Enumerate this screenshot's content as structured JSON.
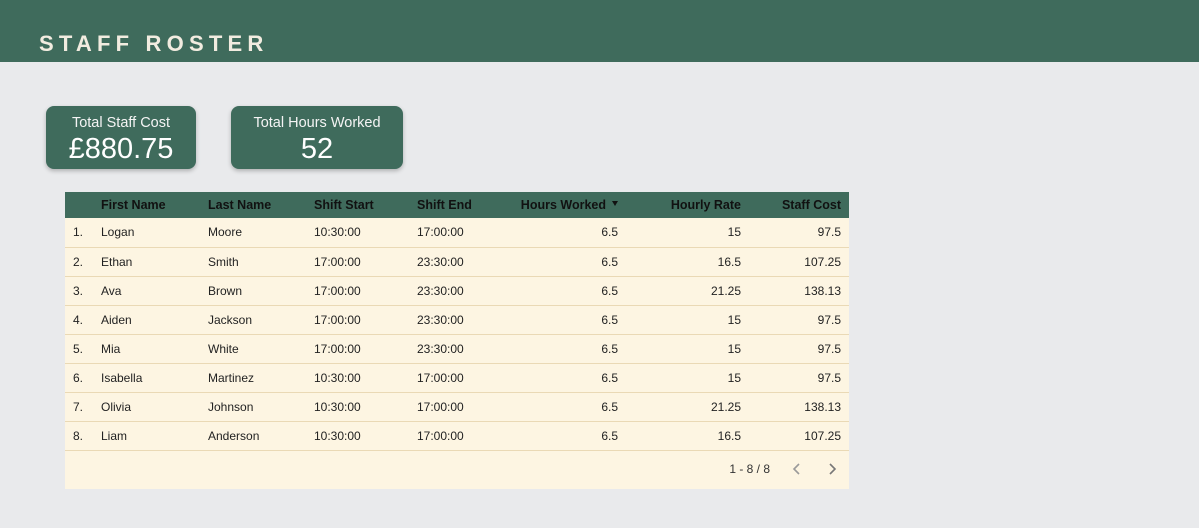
{
  "header": {
    "title": "STAFF ROSTER"
  },
  "scorecards": {
    "cost": {
      "label": "Total Staff Cost",
      "value": "£880.75"
    },
    "hours": {
      "label": "Total Hours Worked",
      "value": "52"
    }
  },
  "table": {
    "columns": [
      "First Name",
      "Last Name",
      "Shift Start",
      "Shift End",
      "Hours Worked",
      "Hourly Rate",
      "Staff Cost"
    ],
    "sort_column": "Hours Worked",
    "rows": [
      {
        "idx": "1.",
        "first": "Logan",
        "last": "Moore",
        "start": "10:30:00",
        "end": "17:00:00",
        "hours": "6.5",
        "rate": "15",
        "cost": "97.5"
      },
      {
        "idx": "2.",
        "first": "Ethan",
        "last": "Smith",
        "start": "17:00:00",
        "end": "23:30:00",
        "hours": "6.5",
        "rate": "16.5",
        "cost": "107.25"
      },
      {
        "idx": "3.",
        "first": "Ava",
        "last": "Brown",
        "start": "17:00:00",
        "end": "23:30:00",
        "hours": "6.5",
        "rate": "21.25",
        "cost": "138.13"
      },
      {
        "idx": "4.",
        "first": "Aiden",
        "last": "Jackson",
        "start": "17:00:00",
        "end": "23:30:00",
        "hours": "6.5",
        "rate": "15",
        "cost": "97.5"
      },
      {
        "idx": "5.",
        "first": "Mia",
        "last": "White",
        "start": "17:00:00",
        "end": "23:30:00",
        "hours": "6.5",
        "rate": "15",
        "cost": "97.5"
      },
      {
        "idx": "6.",
        "first": "Isabella",
        "last": "Martinez",
        "start": "10:30:00",
        "end": "17:00:00",
        "hours": "6.5",
        "rate": "15",
        "cost": "97.5"
      },
      {
        "idx": "7.",
        "first": "Olivia",
        "last": "Johnson",
        "start": "10:30:00",
        "end": "17:00:00",
        "hours": "6.5",
        "rate": "21.25",
        "cost": "138.13"
      },
      {
        "idx": "8.",
        "first": "Liam",
        "last": "Anderson",
        "start": "10:30:00",
        "end": "17:00:00",
        "hours": "6.5",
        "rate": "16.5",
        "cost": "107.25"
      }
    ],
    "pagination": "1 - 8 / 8"
  },
  "colors": {
    "header_bg": "#3f6b5c",
    "table_bg": "#fdf5e2",
    "page_bg": "#e9eaec"
  },
  "icons": {
    "sort": "sort-desc-icon",
    "prev": "chevron-left-icon",
    "next": "chevron-right-icon"
  }
}
